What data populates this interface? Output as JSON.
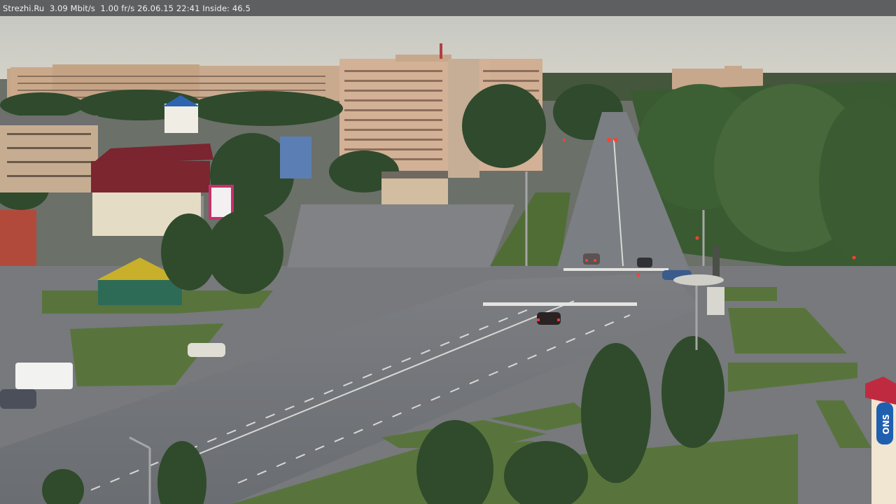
{
  "overlay": {
    "site": "Strezhi.Ru",
    "bitrate": "3.09 Mbit/s",
    "framerate": "1.00 fr/s",
    "date": "26.06.15",
    "time": "22:41",
    "inside": "Inside: 46.5"
  },
  "signage": {
    "store_sign": "ONS"
  },
  "colors": {
    "sky": "#c9c9c0",
    "road": "#72757a",
    "grass": "#56713b",
    "trees": "#2f4a2a",
    "buildings": "#c9a98c",
    "osd_bar": "#5d5f60"
  }
}
